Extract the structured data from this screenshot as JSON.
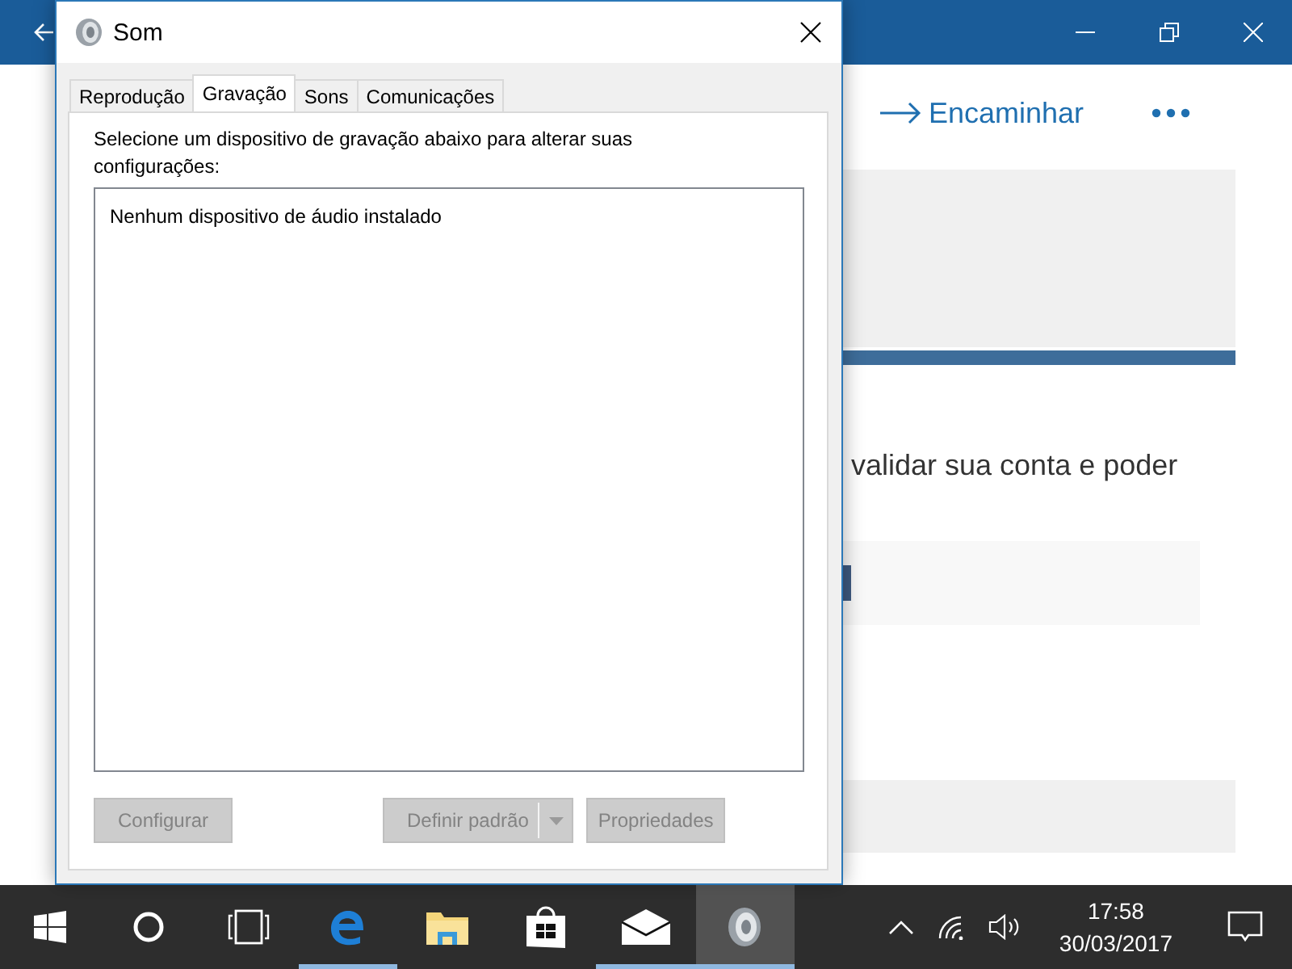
{
  "background_window": {
    "forward_button": "Encaminhar",
    "body_text": "validar sua conta e poder"
  },
  "dialog": {
    "title": "Som",
    "tabs": [
      {
        "label": "Reprodução",
        "selected": false
      },
      {
        "label": "Gravação",
        "selected": true
      },
      {
        "label": "Sons",
        "selected": false
      },
      {
        "label": "Comunicações",
        "selected": false
      }
    ],
    "instruction": "Selecione um dispositivo de gravação abaixo para alterar suas configurações:",
    "device_list": {
      "empty_message": "Nenhum dispositivo de áudio instalado"
    },
    "device_buttons": [
      {
        "label": "Configurar",
        "disabled": true,
        "kind": "plain"
      },
      {
        "label": "Definir padrão",
        "disabled": true,
        "kind": "split"
      },
      {
        "label": "Propriedades",
        "disabled": true,
        "kind": "plain"
      }
    ]
  },
  "taskbar": {
    "apps": [
      {
        "kind": "start",
        "active": false,
        "highlighted": false
      },
      {
        "kind": "search",
        "active": false,
        "highlighted": false
      },
      {
        "kind": "taskview",
        "active": false,
        "highlighted": false
      },
      {
        "kind": "browser",
        "active": true,
        "highlighted": false
      },
      {
        "kind": "folder",
        "active": false,
        "highlighted": false
      },
      {
        "kind": "store",
        "active": false,
        "highlighted": false
      },
      {
        "kind": "mail",
        "active": true,
        "highlighted": false
      },
      {
        "kind": "speaker",
        "active": true,
        "highlighted": true
      }
    ],
    "clock": {
      "time": "17:58",
      "date": "30/03/2017"
    }
  }
}
